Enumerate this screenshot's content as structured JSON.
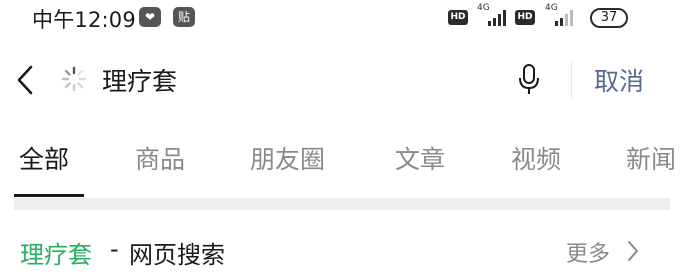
{
  "status_bar": {
    "time": "中午12:09",
    "app_icons": [
      "❤",
      "贴"
    ],
    "hd_badges": [
      "HD",
      "HD"
    ],
    "network": [
      "4G",
      "4G"
    ],
    "battery": "37"
  },
  "search": {
    "query": "理疗套",
    "cancel_label": "取消"
  },
  "tabs": [
    {
      "label": "全部",
      "active": true
    },
    {
      "label": "商品",
      "active": false
    },
    {
      "label": "朋友圈",
      "active": false
    },
    {
      "label": "文章",
      "active": false
    },
    {
      "label": "视频",
      "active": false
    },
    {
      "label": "新闻",
      "active": false
    }
  ],
  "result_section": {
    "keyword": "理疗套",
    "separator": "-",
    "title": "网页搜索",
    "more_label": "更多"
  },
  "colors": {
    "accent_green": "#2aae67",
    "cancel_blue": "#576b95",
    "inactive_gray": "#8a8a8a"
  }
}
